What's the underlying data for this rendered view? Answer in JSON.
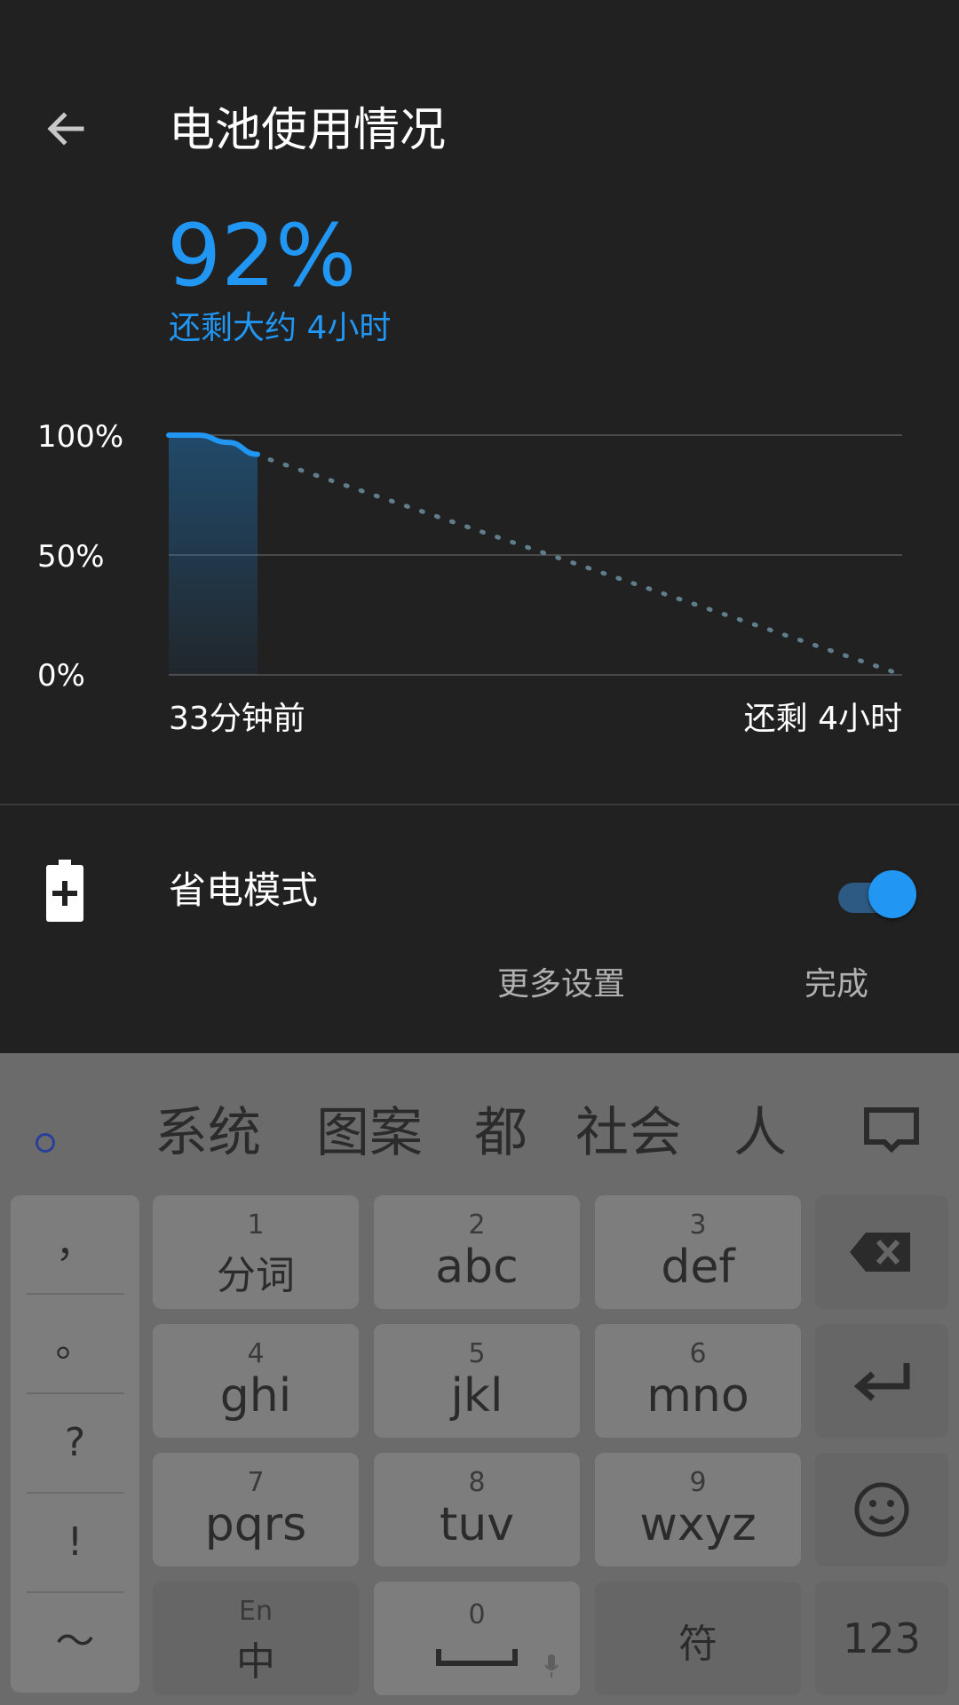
{
  "header": {
    "title": "电池使用情况"
  },
  "battery": {
    "percent": "92%",
    "remaining": "还剩大约 4小时"
  },
  "chart": {
    "y_labels": [
      "100%",
      "50%",
      "0%"
    ],
    "x_start_label": "33分钟前",
    "x_end_label": "还剩 4小时"
  },
  "chart_data": {
    "type": "area",
    "y_ticks": [
      "100%",
      "50%",
      "0%"
    ],
    "ylim": [
      0,
      100
    ],
    "x_labels": [
      "33分钟前",
      "还剩 4小时"
    ],
    "series": [
      {
        "values": [
          100,
          100,
          97,
          92
        ]
      },
      {
        "values": [
          92,
          0
        ]
      }
    ],
    "colors": {
      "usage": "#2196f3",
      "projection": "#607d8b"
    }
  },
  "battery_saver": {
    "label": "省电模式",
    "enabled": true
  },
  "actions": {
    "more_settings": "更多设置",
    "done": "完成"
  },
  "keyboard": {
    "candidates": [
      "系统",
      "图案",
      "都",
      "社会",
      "人"
    ],
    "punctuation": [
      "，",
      "。",
      "?",
      "!",
      "～"
    ],
    "keys": [
      {
        "num": "1",
        "label": "分词"
      },
      {
        "num": "2",
        "label": "abc"
      },
      {
        "num": "3",
        "label": "def"
      },
      {
        "num": "4",
        "label": "ghi"
      },
      {
        "num": "5",
        "label": "jkl"
      },
      {
        "num": "6",
        "label": "mno"
      },
      {
        "num": "7",
        "label": "pqrs"
      },
      {
        "num": "8",
        "label": "tuv"
      },
      {
        "num": "9",
        "label": "wxyz"
      }
    ],
    "bottom": {
      "lang_top": "En",
      "lang_main": "中",
      "space_num": "0",
      "symbols": "符",
      "numbers": "123"
    }
  },
  "colors": {
    "accent": "#2196f3",
    "background": "#212121"
  }
}
